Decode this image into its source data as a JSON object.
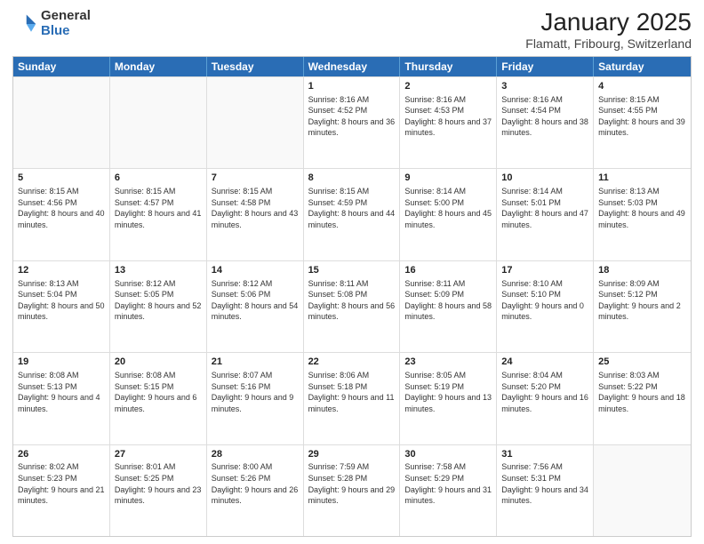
{
  "logo": {
    "general": "General",
    "blue": "Blue"
  },
  "title": {
    "main": "January 2025",
    "sub": "Flamatt, Fribourg, Switzerland"
  },
  "header_days": [
    "Sunday",
    "Monday",
    "Tuesday",
    "Wednesday",
    "Thursday",
    "Friday",
    "Saturday"
  ],
  "weeks": [
    {
      "days": [
        {
          "num": "",
          "info": "",
          "empty": true
        },
        {
          "num": "",
          "info": "",
          "empty": true
        },
        {
          "num": "",
          "info": "",
          "empty": true
        },
        {
          "num": "1",
          "info": "Sunrise: 8:16 AM\nSunset: 4:52 PM\nDaylight: 8 hours and 36 minutes.",
          "empty": false
        },
        {
          "num": "2",
          "info": "Sunrise: 8:16 AM\nSunset: 4:53 PM\nDaylight: 8 hours and 37 minutes.",
          "empty": false
        },
        {
          "num": "3",
          "info": "Sunrise: 8:16 AM\nSunset: 4:54 PM\nDaylight: 8 hours and 38 minutes.",
          "empty": false
        },
        {
          "num": "4",
          "info": "Sunrise: 8:15 AM\nSunset: 4:55 PM\nDaylight: 8 hours and 39 minutes.",
          "empty": false
        }
      ]
    },
    {
      "days": [
        {
          "num": "5",
          "info": "Sunrise: 8:15 AM\nSunset: 4:56 PM\nDaylight: 8 hours and 40 minutes.",
          "empty": false
        },
        {
          "num": "6",
          "info": "Sunrise: 8:15 AM\nSunset: 4:57 PM\nDaylight: 8 hours and 41 minutes.",
          "empty": false
        },
        {
          "num": "7",
          "info": "Sunrise: 8:15 AM\nSunset: 4:58 PM\nDaylight: 8 hours and 43 minutes.",
          "empty": false
        },
        {
          "num": "8",
          "info": "Sunrise: 8:15 AM\nSunset: 4:59 PM\nDaylight: 8 hours and 44 minutes.",
          "empty": false
        },
        {
          "num": "9",
          "info": "Sunrise: 8:14 AM\nSunset: 5:00 PM\nDaylight: 8 hours and 45 minutes.",
          "empty": false
        },
        {
          "num": "10",
          "info": "Sunrise: 8:14 AM\nSunset: 5:01 PM\nDaylight: 8 hours and 47 minutes.",
          "empty": false
        },
        {
          "num": "11",
          "info": "Sunrise: 8:13 AM\nSunset: 5:03 PM\nDaylight: 8 hours and 49 minutes.",
          "empty": false
        }
      ]
    },
    {
      "days": [
        {
          "num": "12",
          "info": "Sunrise: 8:13 AM\nSunset: 5:04 PM\nDaylight: 8 hours and 50 minutes.",
          "empty": false
        },
        {
          "num": "13",
          "info": "Sunrise: 8:12 AM\nSunset: 5:05 PM\nDaylight: 8 hours and 52 minutes.",
          "empty": false
        },
        {
          "num": "14",
          "info": "Sunrise: 8:12 AM\nSunset: 5:06 PM\nDaylight: 8 hours and 54 minutes.",
          "empty": false
        },
        {
          "num": "15",
          "info": "Sunrise: 8:11 AM\nSunset: 5:08 PM\nDaylight: 8 hours and 56 minutes.",
          "empty": false
        },
        {
          "num": "16",
          "info": "Sunrise: 8:11 AM\nSunset: 5:09 PM\nDaylight: 8 hours and 58 minutes.",
          "empty": false
        },
        {
          "num": "17",
          "info": "Sunrise: 8:10 AM\nSunset: 5:10 PM\nDaylight: 9 hours and 0 minutes.",
          "empty": false
        },
        {
          "num": "18",
          "info": "Sunrise: 8:09 AM\nSunset: 5:12 PM\nDaylight: 9 hours and 2 minutes.",
          "empty": false
        }
      ]
    },
    {
      "days": [
        {
          "num": "19",
          "info": "Sunrise: 8:08 AM\nSunset: 5:13 PM\nDaylight: 9 hours and 4 minutes.",
          "empty": false
        },
        {
          "num": "20",
          "info": "Sunrise: 8:08 AM\nSunset: 5:15 PM\nDaylight: 9 hours and 6 minutes.",
          "empty": false
        },
        {
          "num": "21",
          "info": "Sunrise: 8:07 AM\nSunset: 5:16 PM\nDaylight: 9 hours and 9 minutes.",
          "empty": false
        },
        {
          "num": "22",
          "info": "Sunrise: 8:06 AM\nSunset: 5:18 PM\nDaylight: 9 hours and 11 minutes.",
          "empty": false
        },
        {
          "num": "23",
          "info": "Sunrise: 8:05 AM\nSunset: 5:19 PM\nDaylight: 9 hours and 13 minutes.",
          "empty": false
        },
        {
          "num": "24",
          "info": "Sunrise: 8:04 AM\nSunset: 5:20 PM\nDaylight: 9 hours and 16 minutes.",
          "empty": false
        },
        {
          "num": "25",
          "info": "Sunrise: 8:03 AM\nSunset: 5:22 PM\nDaylight: 9 hours and 18 minutes.",
          "empty": false
        }
      ]
    },
    {
      "days": [
        {
          "num": "26",
          "info": "Sunrise: 8:02 AM\nSunset: 5:23 PM\nDaylight: 9 hours and 21 minutes.",
          "empty": false
        },
        {
          "num": "27",
          "info": "Sunrise: 8:01 AM\nSunset: 5:25 PM\nDaylight: 9 hours and 23 minutes.",
          "empty": false
        },
        {
          "num": "28",
          "info": "Sunrise: 8:00 AM\nSunset: 5:26 PM\nDaylight: 9 hours and 26 minutes.",
          "empty": false
        },
        {
          "num": "29",
          "info": "Sunrise: 7:59 AM\nSunset: 5:28 PM\nDaylight: 9 hours and 29 minutes.",
          "empty": false
        },
        {
          "num": "30",
          "info": "Sunrise: 7:58 AM\nSunset: 5:29 PM\nDaylight: 9 hours and 31 minutes.",
          "empty": false
        },
        {
          "num": "31",
          "info": "Sunrise: 7:56 AM\nSunset: 5:31 PM\nDaylight: 9 hours and 34 minutes.",
          "empty": false
        },
        {
          "num": "",
          "info": "",
          "empty": true
        }
      ]
    }
  ]
}
